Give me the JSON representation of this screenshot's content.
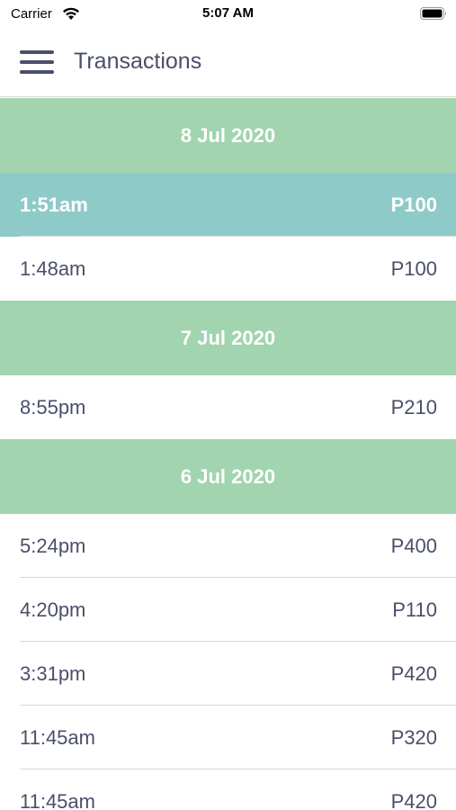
{
  "status_bar": {
    "carrier": "Carrier",
    "time": "5:07 AM"
  },
  "nav": {
    "title": "Transactions"
  },
  "groups": [
    {
      "date": "8 Jul 2020",
      "rows": [
        {
          "time": "1:51am",
          "amount": "P100",
          "selected": true
        },
        {
          "time": "1:48am",
          "amount": "P100"
        }
      ]
    },
    {
      "date": "7 Jul 2020",
      "rows": [
        {
          "time": "8:55pm",
          "amount": "P210"
        }
      ]
    },
    {
      "date": "6 Jul 2020",
      "rows": [
        {
          "time": "5:24pm",
          "amount": "P400"
        },
        {
          "time": "4:20pm",
          "amount": "P110"
        },
        {
          "time": "3:31pm",
          "amount": "P420"
        },
        {
          "time": "11:45am",
          "amount": "P320"
        },
        {
          "time": "11:45am",
          "amount": "P420"
        }
      ]
    }
  ],
  "colors": {
    "date_header_bg": "#a2d4b0",
    "selected_row_bg": "#8ecac8",
    "text": "#4a4f6a"
  }
}
